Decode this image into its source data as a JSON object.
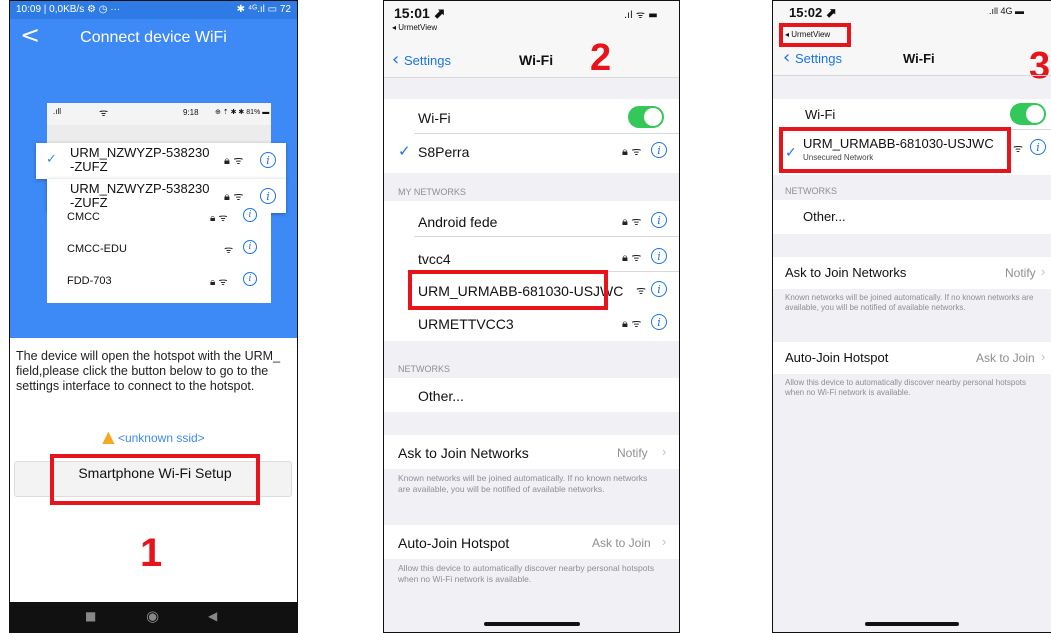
{
  "android": {
    "statusbar": {
      "left": "10:09 | 0,0KB/s ⚙ ◷ ···",
      "right": "✱ ⁴ᴳ.ıl ▭ 72"
    },
    "title": "Connect device WiFi",
    "back": "<",
    "inner_status": {
      "time": "9:18",
      "right": "⊕ ⇡ ✱ ✱ 81% ▬"
    },
    "networks": [
      {
        "name": "URM_NZWYZP-538230\n-ZUFZ",
        "lock": true
      },
      {
        "name": "URM_NZWYZP-538230\n-ZUFZ",
        "lock": true
      },
      {
        "name": "CMCC",
        "lock": true
      },
      {
        "name": "CMCC-EDU",
        "lock": false
      },
      {
        "name": "FDD-703",
        "lock": true
      }
    ],
    "description": "The device will open the hotspot with the URM_ field,please click the button below to go to the settings interface to connect to the hotspot.",
    "warning": "<unknown ssid>",
    "button": "Smartphone Wi-Fi Setup",
    "step": "1",
    "nav": {
      "square": "■",
      "circle": "◉",
      "back": "◀"
    }
  },
  "ios2": {
    "time": "15:01 ⬈",
    "back_app": "◂ UrmetView",
    "nav_back": "Settings",
    "nav_title": "Wi-Fi",
    "step": "2",
    "wifi_label": "Wi-Fi",
    "current": "S8Perra",
    "my_networks_header": "MY NETWORKS",
    "my_networks": [
      "Android fede",
      "tvcc4",
      "URM_URMABB-681030-USJWC",
      "URMETTVCC3"
    ],
    "networks_header": "NETWORKS",
    "other": "Other...",
    "ask_label": "Ask to Join Networks",
    "ask_value": "Notify",
    "ask_note": "Known networks will be joined automatically. If no known networks are available, you will be notified of available networks.",
    "hotspot_label": "Auto-Join Hotspot",
    "hotspot_value": "Ask to Join",
    "hotspot_note": "Allow this device to automatically discover nearby personal hotspots when no Wi-Fi network is available."
  },
  "ios3": {
    "time": "15:02 ⬈",
    "back_app": "◂ UrmetView",
    "status_right": ".ıll 4G ▬",
    "nav_back": "Settings",
    "nav_title": "Wi-Fi",
    "step": "3",
    "wifi_label": "Wi-Fi",
    "current": "URM_URMABB-681030-USJWC",
    "current_sub": "Unsecured Network",
    "networks_header": "NETWORKS",
    "other": "Other...",
    "ask_label": "Ask to Join Networks",
    "ask_value": "Notify",
    "ask_note": "Known networks will be joined automatically. If no known networks are available, you will be notified of available networks.",
    "hotspot_label": "Auto-Join Hotspot",
    "hotspot_value": "Ask to Join",
    "hotspot_note": "Allow this device to automatically discover nearby personal hotspots when no Wi-Fi network is available."
  },
  "colors": {
    "android_blue": "#3d8af7",
    "ios_blue": "#1a73e8",
    "toggle_green": "#34c759",
    "highlight_red": "#e8141b"
  }
}
